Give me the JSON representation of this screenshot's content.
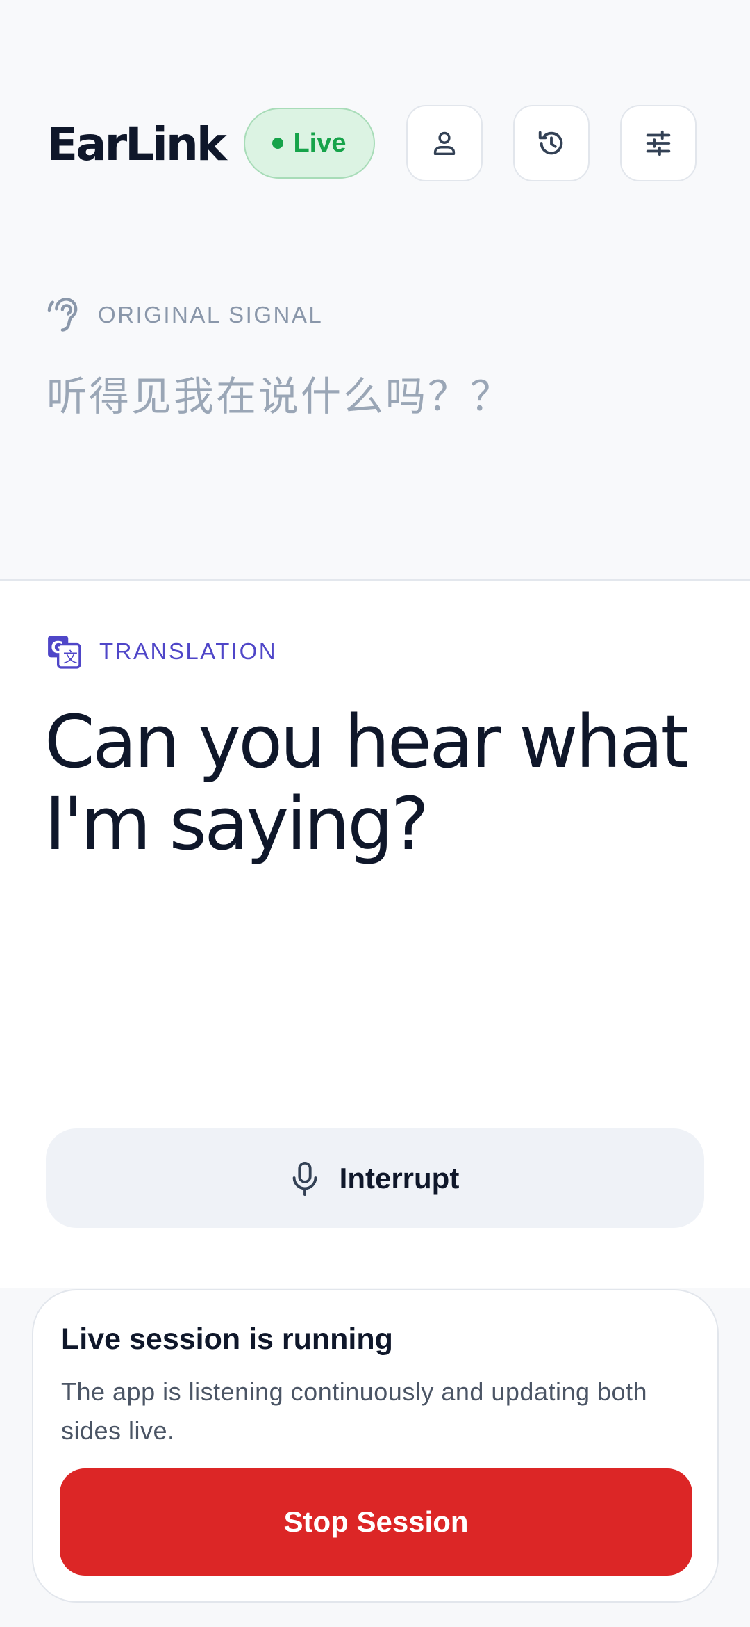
{
  "header": {
    "app_name": "EarLink",
    "status_label": "Live",
    "colors": {
      "live": "#16a34a",
      "live_bg": "#dcf3e3"
    },
    "actions": [
      {
        "icon": "profile-icon"
      },
      {
        "icon": "history-icon"
      },
      {
        "icon": "settings-sliders-icon"
      }
    ]
  },
  "original": {
    "label": "ORIGINAL SIGNAL",
    "icon": "ear-icon",
    "text": "听得见我在说什么吗？？"
  },
  "translation": {
    "label": "TRANSLATION",
    "icon": "translate-icon",
    "text": "Can you hear what I'm saying?",
    "accent": "#4f46c8"
  },
  "interrupt": {
    "label": "Interrupt",
    "icon": "microphone-icon"
  },
  "session": {
    "title": "Live session is running",
    "description": "The app is listening continuously and updating both sides live.",
    "stop_label": "Stop Session",
    "stop_color": "#dc2626"
  }
}
